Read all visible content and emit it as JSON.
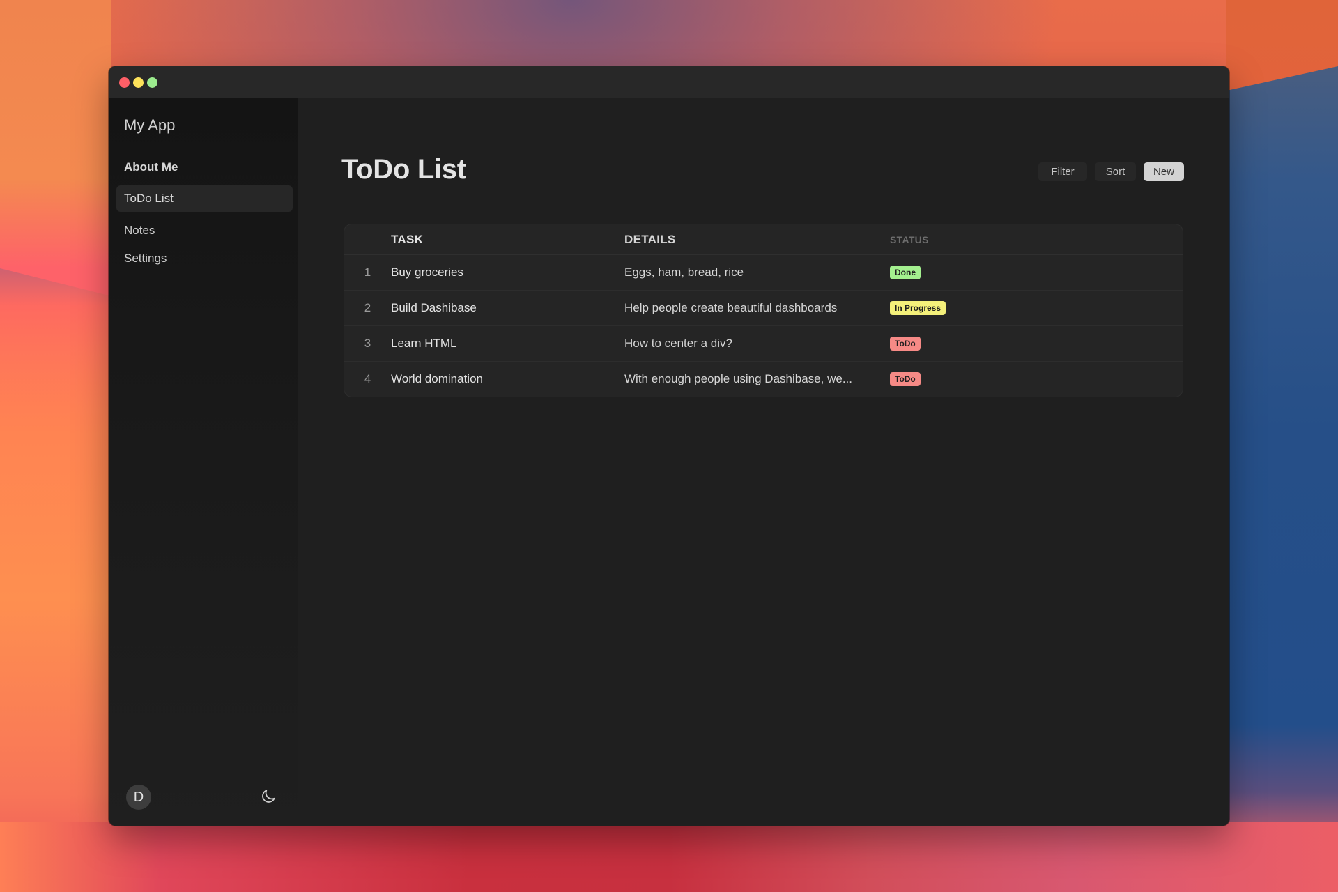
{
  "window": {
    "traffic_lights": [
      {
        "name": "close",
        "color": "#fe5f67"
      },
      {
        "name": "minimize",
        "color": "#fde25a"
      },
      {
        "name": "maximize",
        "color": "#9ceb8e"
      }
    ]
  },
  "sidebar": {
    "app_name": "My App",
    "items": [
      {
        "label": "About Me",
        "active": false
      },
      {
        "label": "ToDo List",
        "active": true
      },
      {
        "label": "Notes",
        "active": false
      },
      {
        "label": "Settings",
        "active": false
      }
    ],
    "avatar_initial": "D",
    "theme_icon": "moon-icon"
  },
  "main": {
    "title": "ToDo List",
    "actions": {
      "filter_label": "Filter",
      "sort_label": "Sort",
      "new_label": "New"
    },
    "table": {
      "columns": [
        "",
        "Task",
        "Details",
        "Status"
      ],
      "rows": [
        {
          "num": "1",
          "task": "Buy groceries",
          "details": "Eggs, ham, bread, rice",
          "status": "Done",
          "status_color": "#a4f08f"
        },
        {
          "num": "2",
          "task": "Build Dashibase",
          "details": "Help people create beautiful dashboards",
          "status": "In Progress",
          "status_color": "#f4f07a"
        },
        {
          "num": "3",
          "task": "Learn HTML",
          "details": "How to center a div?",
          "status": "ToDo",
          "status_color": "#f68a86"
        },
        {
          "num": "4",
          "task": "World domination",
          "details": "With enough people using Dashibase, we...",
          "status": "ToDo",
          "status_color": "#f68a86"
        }
      ]
    }
  }
}
